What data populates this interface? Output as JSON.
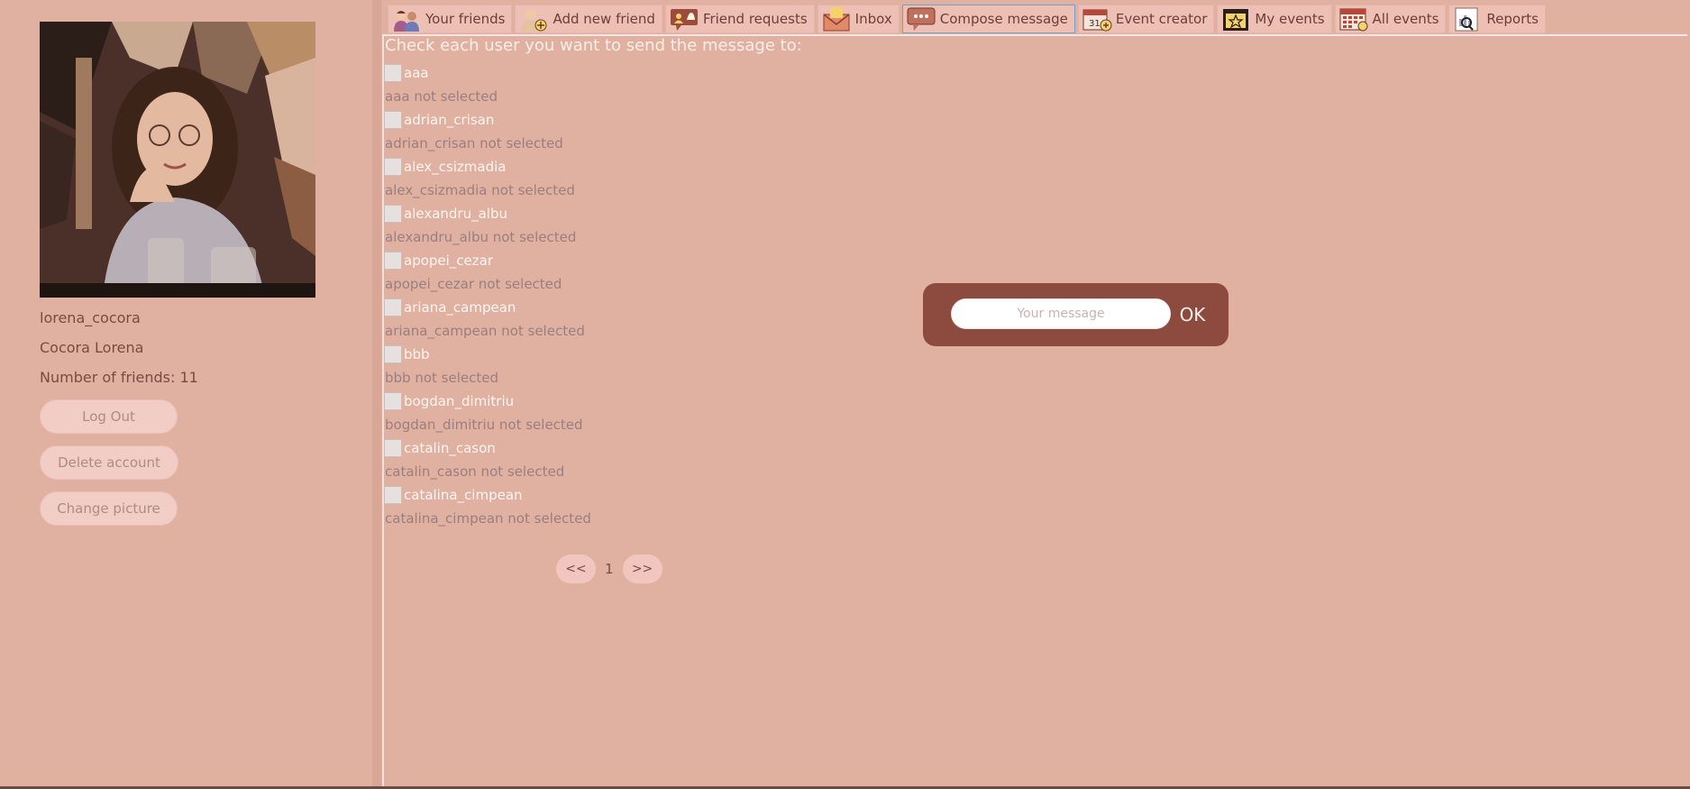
{
  "sidebar": {
    "username": "lorena_cocora",
    "full_name": "Cocora Lorena",
    "friends_count": "Number of friends: 11",
    "buttons": {
      "logout": "Log Out",
      "delete_account": "Delete account",
      "change_picture": "Change picture"
    }
  },
  "tabs": [
    {
      "label": "Your friends",
      "icon": "friends-icon"
    },
    {
      "label": "Add new friend",
      "icon": "add-friend-icon"
    },
    {
      "label": "Friend requests",
      "icon": "friend-requests-icon"
    },
    {
      "label": "Inbox",
      "icon": "inbox-icon"
    },
    {
      "label": "Compose message",
      "icon": "compose-message-icon",
      "active": true
    },
    {
      "label": "Event creator",
      "icon": "calendar-add-icon"
    },
    {
      "label": "My events",
      "icon": "star-calendar-icon"
    },
    {
      "label": "All events",
      "icon": "calendar-grid-icon"
    },
    {
      "label": "Reports",
      "icon": "report-search-icon"
    }
  ],
  "main": {
    "heading": "Check each user you want to send the message to:",
    "users": [
      {
        "name": "aaa",
        "status": "aaa not selected"
      },
      {
        "name": "adrian_crisan",
        "status": "adrian_crisan not selected"
      },
      {
        "name": "alex_csizmadia",
        "status": "alex_csizmadia not selected"
      },
      {
        "name": "alexandru_albu",
        "status": "alexandru_albu not selected"
      },
      {
        "name": "apopei_cezar",
        "status": "apopei_cezar not selected"
      },
      {
        "name": "ariana_campean",
        "status": "ariana_campean not selected"
      },
      {
        "name": "bbb",
        "status": "bbb not selected"
      },
      {
        "name": "bogdan_dimitriu",
        "status": "bogdan_dimitriu not selected"
      },
      {
        "name": "catalin_cason",
        "status": "catalin_cason not selected"
      },
      {
        "name": "catalina_cimpean",
        "status": "catalina_cimpean not selected"
      }
    ],
    "pager": {
      "prev": "<<",
      "page": "1",
      "next": ">>"
    }
  },
  "message": {
    "placeholder": "Your message",
    "ok_label": "OK"
  },
  "colors": {
    "background": "#e0b1a1",
    "message_box": "#8d4b40",
    "button": "#f1cdc6",
    "active_tab_border": "#6fa0d0"
  }
}
